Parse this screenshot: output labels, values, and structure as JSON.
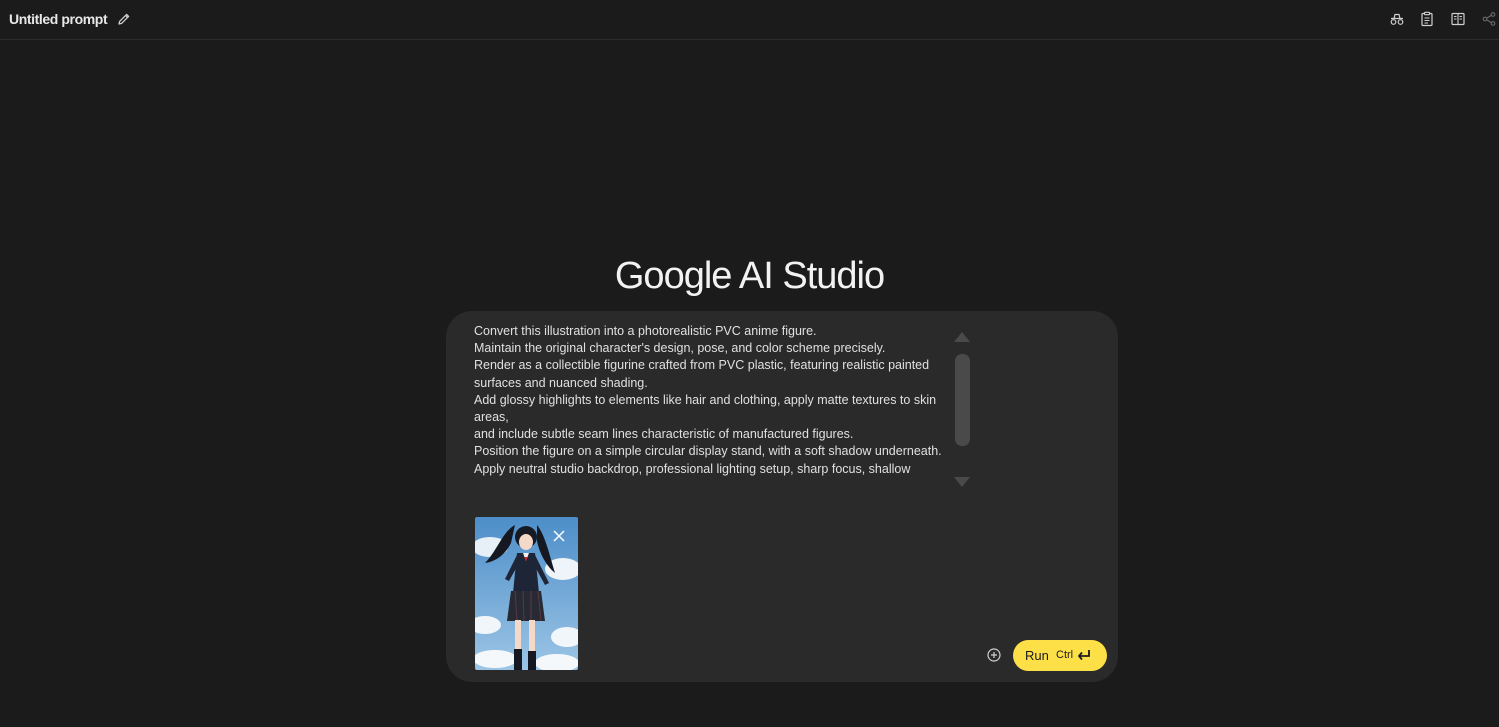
{
  "header": {
    "title": "Untitled prompt",
    "icons": [
      "edit-icon",
      "compare-icon",
      "clipboard-icon",
      "book-icon",
      "share-icon"
    ]
  },
  "brand": {
    "google": "Google",
    "product": "AI Studio"
  },
  "prompt": {
    "text": "Convert this illustration into a photorealistic PVC anime figure.\nMaintain the original character's design, pose, and color scheme precisely.\nRender as a collectible figurine crafted from PVC plastic, featuring realistic painted surfaces and nuanced shading.\nAdd glossy highlights to elements like hair and clothing, apply matte textures to skin areas,\nand include subtle seam lines characteristic of manufactured figures.\nPosition the figure on a simple circular display stand, with a soft shadow underneath.\nApply neutral studio backdrop, professional lighting setup, sharp focus, shallow",
    "attachment_icon": "anime-girl-image",
    "remove_icon": "close-icon"
  },
  "actions": {
    "add_icon": "add-circle-icon",
    "run_label": "Run",
    "run_shortcut": "Ctrl",
    "enter_icon": "enter-icon",
    "run_color": "#fde047"
  }
}
